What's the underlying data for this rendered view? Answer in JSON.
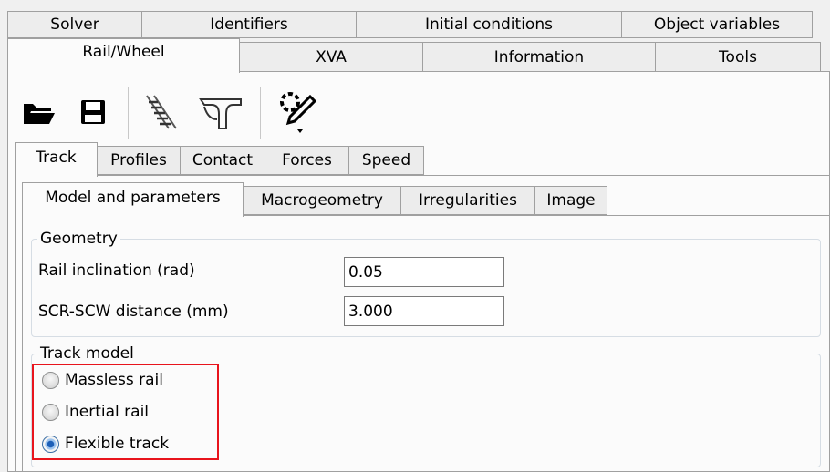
{
  "top_tabs_row1": [
    "Solver",
    "Identifiers",
    "Initial conditions",
    "Object variables"
  ],
  "top_tabs_row2": [
    "Rail/Wheel",
    "XVA",
    "Information",
    "Tools"
  ],
  "toolbar": {
    "icons": [
      "open-folder-icon",
      "save-icon",
      "track-icon",
      "wheel-profile-icon",
      "settings-edit-icon"
    ]
  },
  "rail_tabs": [
    "Track",
    "Profiles",
    "Contact",
    "Forces",
    "Speed"
  ],
  "track_tabs": [
    "Model and parameters",
    "Macrogeometry",
    "Irregularities",
    "Image"
  ],
  "geometry": {
    "title": "Geometry",
    "rail_inclination_label": "Rail inclination (rad)",
    "rail_inclination_value": "0.05",
    "scr_scw_label": "SCR-SCW distance (mm)",
    "scr_scw_value": "3.000"
  },
  "track_model": {
    "title": "Track model",
    "options": [
      "Massless rail",
      "Inertial rail",
      "Flexible track"
    ],
    "selected": "Flexible track",
    "highlight_color": "#e8141c"
  }
}
